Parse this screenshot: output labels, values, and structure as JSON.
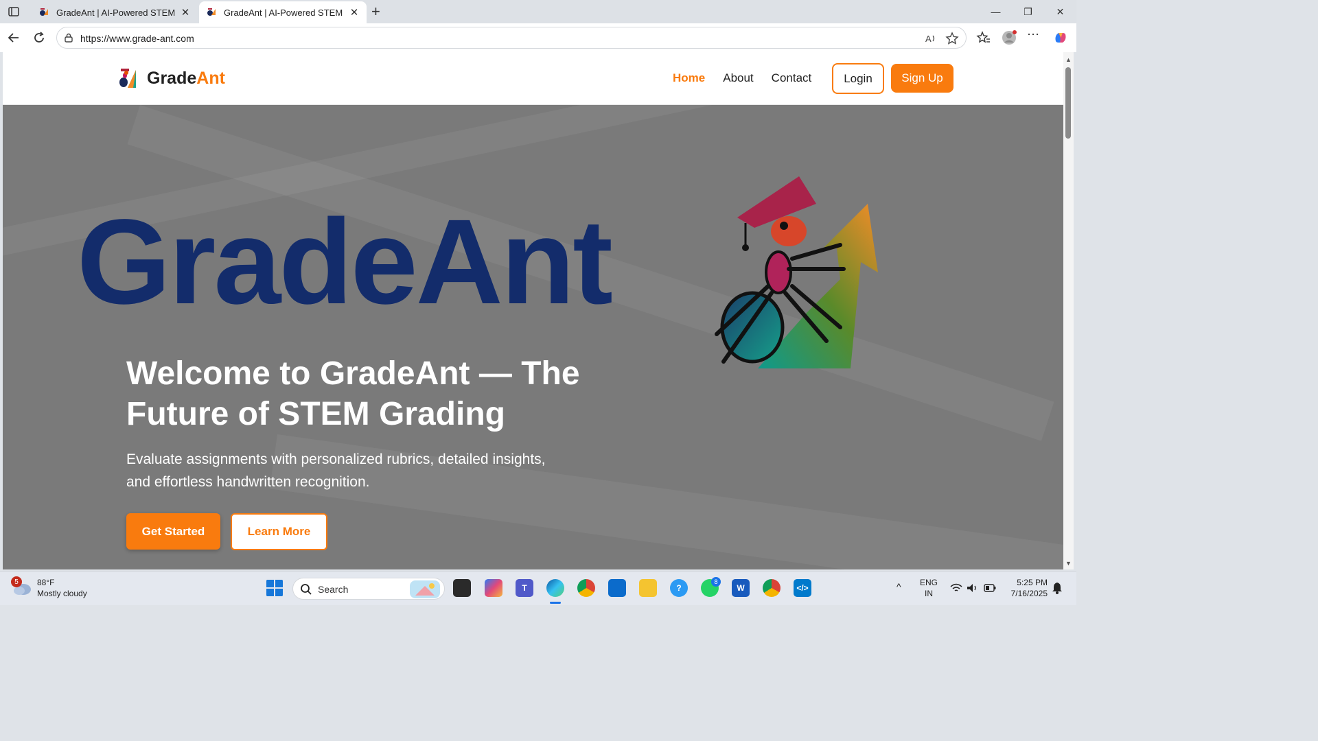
{
  "browser": {
    "tabs": [
      {
        "title": "GradeAnt | AI-Powered STEM Home",
        "active": false
      },
      {
        "title": "GradeAnt | AI-Powered STEM Home",
        "active": true
      }
    ],
    "url": "https://www.grade-ant.com"
  },
  "site": {
    "brand_main": "Grade",
    "brand_accent": "Ant",
    "nav": [
      {
        "label": "Home",
        "active": true
      },
      {
        "label": "About",
        "active": false
      },
      {
        "label": "Contact",
        "active": false
      }
    ],
    "login_label": "Login",
    "signup_label": "Sign Up",
    "accent_color": "#f97b0e",
    "navy_color": "#132c6b"
  },
  "hero": {
    "big_wordmark": "GradeAnt",
    "headline": "Welcome to GradeAnt — The Future of STEM Grading",
    "subtext": "Evaluate assignments with personalized rubrics, detailed insights, and effortless handwritten recognition.",
    "cta_primary": "Get Started",
    "cta_secondary": "Learn More"
  },
  "taskbar": {
    "weather_badge": "5",
    "temperature": "88°F",
    "condition": "Mostly cloudy",
    "search_placeholder": "Search",
    "teams_badge": "",
    "whatsapp_badge": "8",
    "lang_top": "ENG",
    "lang_bottom": "IN",
    "time": "5:25 PM",
    "date": "7/16/2025"
  }
}
